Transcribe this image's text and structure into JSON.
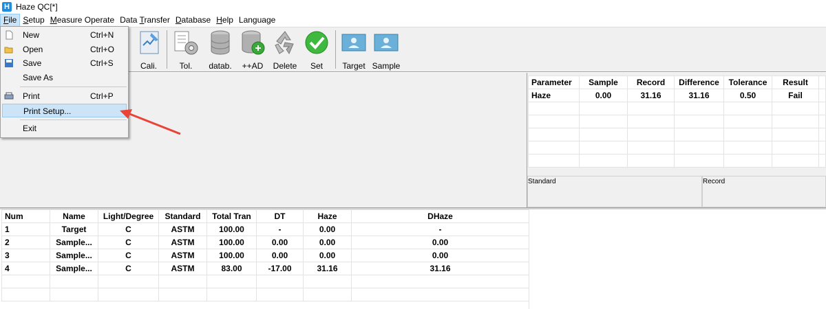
{
  "window": {
    "title": "Haze QC[*]",
    "app_icon_letter": "H"
  },
  "menubar": {
    "items": [
      {
        "label": "File",
        "u": "F",
        "rest": "ile"
      },
      {
        "label": "Setup",
        "u": "S",
        "rest": "etup"
      },
      {
        "label": "Measure Operate",
        "u": "M",
        "rest": "easure Operate"
      },
      {
        "label": "Data Transfer",
        "pre": "Data ",
        "u": "T",
        "rest": "ransfer"
      },
      {
        "label": "Database",
        "u": "D",
        "rest": "atabase"
      },
      {
        "label": "Help",
        "u": "H",
        "rest": "elp"
      },
      {
        "label": "Language"
      }
    ]
  },
  "toolbar": {
    "cali": "Cali.",
    "tol": "Tol.",
    "datab": "datab.",
    "add": "++AD",
    "delete": "Delete",
    "set": "Set",
    "target": "Target",
    "sample": "Sample"
  },
  "file_menu": {
    "new": {
      "label": "New",
      "shortcut": "Ctrl+N"
    },
    "open": {
      "label": "Open",
      "shortcut": "Ctrl+O"
    },
    "save": {
      "label": "Save",
      "shortcut": "Ctrl+S"
    },
    "save_as": {
      "label": "Save As"
    },
    "print": {
      "label": "Print",
      "shortcut": "Ctrl+P"
    },
    "print_setup": {
      "label": "Print Setup..."
    },
    "exit": {
      "label": "Exit"
    }
  },
  "param_table": {
    "headers": [
      "Parameter",
      "Sample",
      "Record",
      "Difference",
      "Tolerance",
      "Result"
    ],
    "rows": [
      [
        "Haze",
        "0.00",
        "31.16",
        "31.16",
        "0.50",
        "Fail"
      ]
    ]
  },
  "std_record": {
    "standard": "Standard",
    "record": "Record"
  },
  "data_table": {
    "headers": [
      "Num",
      "Name",
      "Light/Degree",
      "Standard",
      "Total Tran",
      "DT",
      "Haze",
      "DHaze"
    ],
    "rows": [
      [
        "1",
        "Target",
        "C",
        "ASTM",
        "100.00",
        "-",
        "0.00",
        "-"
      ],
      [
        "2",
        "Sample...",
        "C",
        "ASTM",
        "100.00",
        "0.00",
        "0.00",
        "0.00"
      ],
      [
        "3",
        "Sample...",
        "C",
        "ASTM",
        "100.00",
        "0.00",
        "0.00",
        "0.00"
      ],
      [
        "4",
        "Sample...",
        "C",
        "ASTM",
        "83.00",
        "-17.00",
        "31.16",
        "31.16"
      ]
    ]
  },
  "colors": {
    "accent": "#1e8fe0",
    "highlight": "#cce4f7",
    "annotation_arrow": "#e8443a"
  }
}
